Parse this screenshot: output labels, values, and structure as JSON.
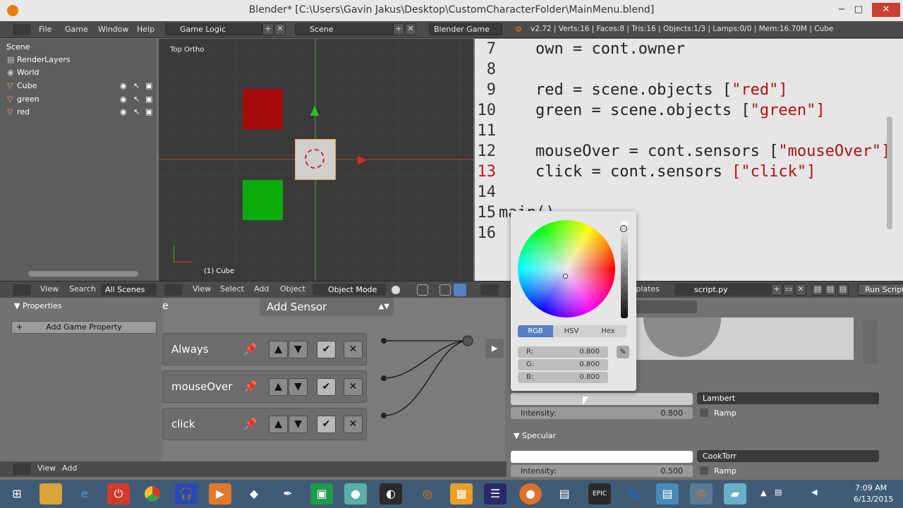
{
  "window": {
    "title": "Blender* [C:\\Users\\Gavin Jakus\\Desktop\\CustomCharacterFolder\\MainMenu.blend]",
    "minimize": "−",
    "maximize": "□",
    "close": "✕"
  },
  "menubar": {
    "items": [
      "File",
      "Game",
      "Window",
      "Help"
    ],
    "screen_layout": "Game Logic",
    "scene": "Scene",
    "engine": "Blender Game",
    "stats": "v2.72 | Verts:16 | Faces:8 | Tris:16 | Objects:1/3 | Lamps:0/0 | Mem:16.70M | Cube"
  },
  "outliner": {
    "items": [
      {
        "label": "Scene",
        "icon": "scene-icon"
      },
      {
        "label": "RenderLayers",
        "icon": "renderlayers-icon"
      },
      {
        "label": "World",
        "icon": "world-icon"
      },
      {
        "label": "Cube",
        "icon": "mesh-icon"
      },
      {
        "label": "green",
        "icon": "mesh-icon"
      },
      {
        "label": "red",
        "icon": "mesh-icon"
      }
    ],
    "header": {
      "view": "View",
      "search": "Search",
      "all_scenes": "All Scenes"
    }
  },
  "viewport": {
    "label": "Top Ortho",
    "object_label": "(1) Cube",
    "header": {
      "view": "View",
      "select": "Select",
      "add": "Add",
      "object": "Object",
      "mode": "Object Mode"
    },
    "colors": {
      "red_obj": "#a50a0a",
      "green_obj": "#0aac0a",
      "selected_obj": "#cfcfcf"
    }
  },
  "text_editor": {
    "lines": [
      {
        "num": "7",
        "text": "own = cont.owner",
        "str": ""
      },
      {
        "num": "8",
        "text": "",
        "str": ""
      },
      {
        "num": "9",
        "text": "red = scene.objects [",
        "str": "\"red\"]"
      },
      {
        "num": "10",
        "text": "green = scene.objects [",
        "str": "\"green\"]"
      },
      {
        "num": "11",
        "text": "",
        "str": ""
      },
      {
        "num": "12",
        "text": "mouseOver = cont.sensors [",
        "str": "\"mouseOver\"]"
      },
      {
        "num": "13",
        "text": "click = cont.sensors ",
        "str": "[\"click\"]"
      },
      {
        "num": "14",
        "text": "",
        "str": ""
      },
      {
        "num": "15",
        "text": "main()",
        "str": ""
      },
      {
        "num": "16",
        "text": "",
        "str": ""
      }
    ],
    "header": {
      "templates": "Templates",
      "filename": "script.py",
      "run": "Run Script"
    }
  },
  "properties": {
    "title": "Properties",
    "add_game_property": "Add Game Property"
  },
  "logic": {
    "add_sensor": "Add Sensor",
    "partial_label": "e",
    "sensors": [
      "Always",
      "mouseOver",
      "click"
    ],
    "footer": {
      "view": "View",
      "add": "Add"
    }
  },
  "color_picker": {
    "tabs": [
      "RGB",
      "HSV",
      "Hex"
    ],
    "active_tab": "RGB",
    "fields": [
      {
        "label": "R:",
        "value": "0.800"
      },
      {
        "label": "G:",
        "value": "0.800"
      },
      {
        "label": "B:",
        "value": "0.800"
      }
    ]
  },
  "material": {
    "diffuse_shader": "Lambert",
    "diffuse_intensity_label": "Intensity:",
    "diffuse_intensity": "0.800",
    "ramp": "Ramp",
    "specular_title": "Specular",
    "specular_shader": "CookTorr",
    "specular_intensity_label": "Intensity:",
    "specular_intensity": "0.500",
    "specular_ramp": "Ramp"
  },
  "taskbar": {
    "time": "7:09 AM",
    "date": "6/13/2015",
    "apps": [
      "windows-start-icon",
      "file-explorer-icon",
      "internet-explorer-icon",
      "power-icon",
      "chrome-icon",
      "headphones-icon",
      "media-icon",
      "unity-icon",
      "inkscape-icon",
      "store-icon",
      "app-icon",
      "steam-icon",
      "blender-icon",
      "paint-icon",
      "eclipse-icon",
      "firefox-icon",
      "network-icon",
      "epic-games-icon",
      "gimp-icon",
      "notepad-icon",
      "blender-active-icon",
      "app2-icon"
    ]
  }
}
